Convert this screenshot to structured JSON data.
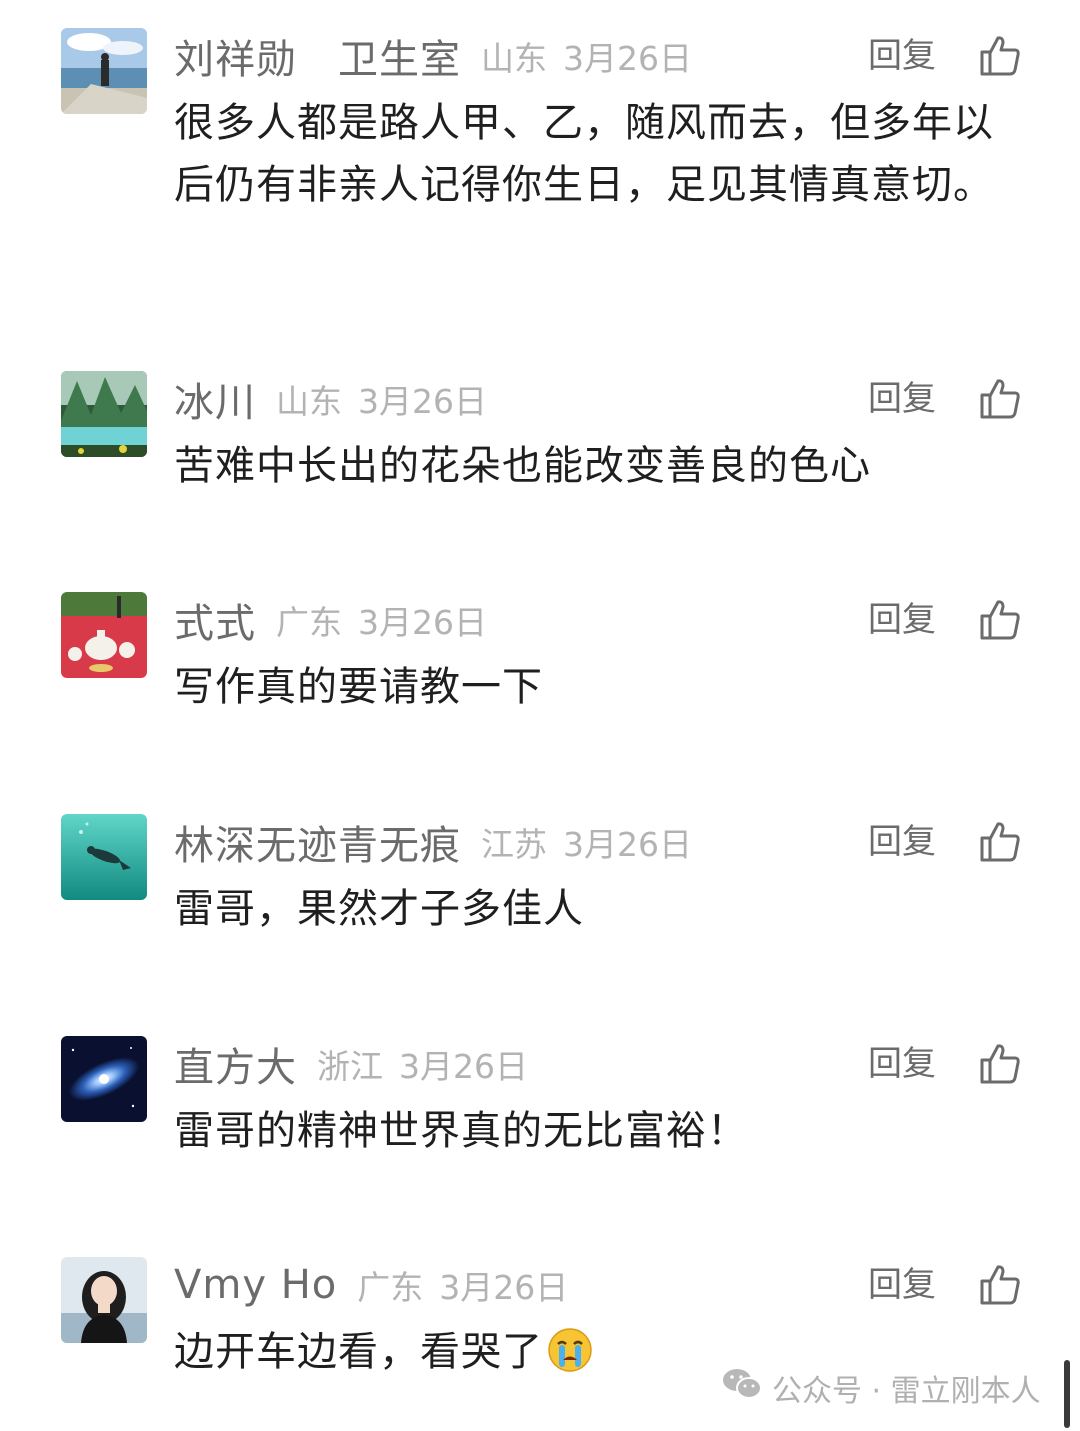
{
  "comments": [
    {
      "nickname": "刘祥勋　卫生室",
      "location": "山东",
      "time": "3月26日",
      "reply_label": "回复",
      "text": "很多人都是路人甲、乙，随风而去，但多年以后仍有非亲人记得你生日，足见其情真意切。",
      "avatar": "person-by-sea-avatar"
    },
    {
      "nickname": "冰川",
      "location": "山东",
      "time": "3月26日",
      "reply_label": "回复",
      "text": "苦难中长出的花朵也能改变善良的色心",
      "avatar": "mountain-lake-avatar"
    },
    {
      "nickname": "式式",
      "location": "广东",
      "time": "3月26日",
      "reply_label": "回复",
      "text": "写作真的要请教一下",
      "avatar": "tea-set-avatar"
    },
    {
      "nickname": "林深无迹青无痕",
      "location": "江苏",
      "time": "3月26日",
      "reply_label": "回复",
      "text": "雷哥，果然才子多佳人",
      "avatar": "diver-underwater-avatar"
    },
    {
      "nickname": "直方大",
      "location": "浙江",
      "time": "3月26日",
      "reply_label": "回复",
      "text": "雷哥的精神世界真的无比富裕！",
      "avatar": "galaxy-avatar"
    },
    {
      "nickname": "Vmy Ho",
      "location": "广东",
      "time": "3月26日",
      "reply_label": "回复",
      "text": "边开车边看，看哭了",
      "avatar": "girl-portrait-avatar",
      "trailing_emoji": "crying-emoji"
    }
  ],
  "watermark": {
    "text": "公众号 · 雷立刚本人",
    "icon": "wechat-icon"
  },
  "colors": {
    "nickname": "#6b6b6b",
    "meta": "#b3b3b3",
    "body": "#1f1f1f"
  }
}
